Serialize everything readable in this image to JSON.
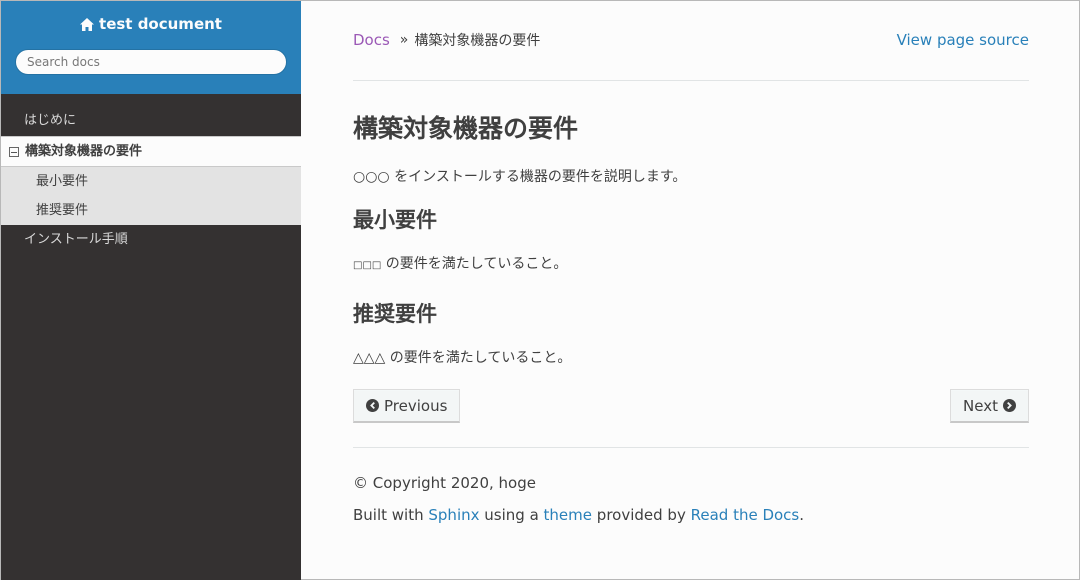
{
  "sidebar": {
    "project_name": "test document",
    "search_placeholder": "Search docs",
    "items": [
      {
        "label": "はじめに"
      },
      {
        "label": "構築対象機器の要件"
      },
      {
        "label": "インストール手順"
      }
    ],
    "subitems": [
      {
        "label": "最小要件"
      },
      {
        "label": "推奨要件"
      }
    ]
  },
  "breadcrumbs": {
    "root": "Docs",
    "separator": "»",
    "current": "構築対象機器の要件",
    "view_source": "View page source"
  },
  "page": {
    "title": "構築対象機器の要件",
    "intro": "○○○ をインストールする機器の要件を説明します。",
    "sections": [
      {
        "heading": "最小要件",
        "body_prefix": "□□□",
        "body_rest": " の要件を満たしていること。"
      },
      {
        "heading": "推奨要件",
        "body": "△△△ の要件を満たしていること。"
      }
    ]
  },
  "nav_buttons": {
    "previous": "Previous",
    "next": "Next"
  },
  "footer": {
    "copyright": "© Copyright 2020, hoge",
    "built_with": "Built with",
    "sphinx": "Sphinx",
    "using_a": "using a",
    "theme": "theme",
    "provided_by": "provided by",
    "rtd": "Read the Docs",
    "period": "."
  },
  "colors": {
    "sidebar_header": "#2980b9",
    "sidebar_bg": "#343131",
    "link": "#2980b9",
    "breadcrumb_link": "#9b59b6"
  }
}
